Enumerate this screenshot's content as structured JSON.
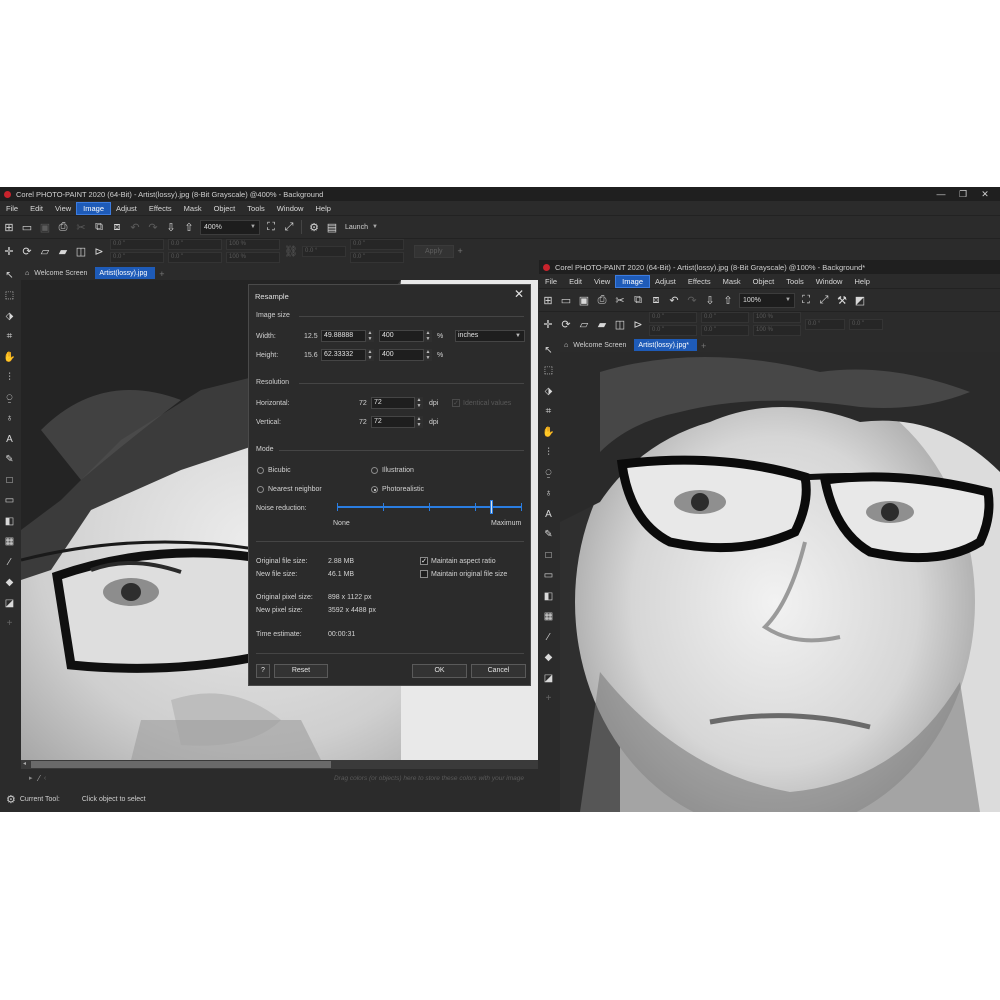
{
  "left_window": {
    "title": "Corel PHOTO-PAINT 2020 (64-Bit) - Artist(lossy).jpg (8-Bit Grayscale) @400% - Background",
    "menu": [
      "File",
      "Edit",
      "View",
      "Image",
      "Adjust",
      "Effects",
      "Mask",
      "Object",
      "Tools",
      "Window",
      "Help"
    ],
    "active_menu": "Image",
    "zoom": "400%",
    "launch_label": "Launch",
    "prop_values": [
      "0.0 \"",
      "0.0 \"",
      "0.0 \"",
      "0.0 \"",
      "100 %",
      "100 %",
      "0.0 °",
      "0.0 \"",
      "0.0 \""
    ],
    "apply_label": "Apply",
    "tabs": [
      "Welcome Screen",
      "Artist(lossy).jpg"
    ],
    "palette_hint": "Drag colors (or objects) here to store these colors with your image",
    "status_label": "Current Tool:",
    "status_value": "Click object to select"
  },
  "dialog": {
    "title": "Resample",
    "image_size_header": "Image size",
    "width_label": "Width:",
    "width_orig": "12.5",
    "width_value": "49.88888",
    "width_pct": "400",
    "height_label": "Height:",
    "height_orig": "15.6",
    "height_value": "62.33332",
    "height_pct": "400",
    "percent_sign": "%",
    "units": "inches",
    "resolution_header": "Resolution",
    "horizontal_label": "Horizontal:",
    "horizontal_orig": "72",
    "horizontal_value": "72",
    "vertical_label": "Vertical:",
    "vertical_orig": "72",
    "vertical_value": "72",
    "dpi": "dpi",
    "identical_values": "Identical values",
    "mode_header": "Mode",
    "mode_bicubic": "Bicubic",
    "mode_illustration": "Illustration",
    "mode_nearest": "Nearest neighbor",
    "mode_photorealistic": "Photorealistic",
    "selected_mode": "Photorealistic",
    "noise_label": "Noise reduction:",
    "noise_min": "None",
    "noise_max": "Maximum",
    "noise_level": 0.84,
    "orig_file_size_label": "Original file size:",
    "orig_file_size": "2.88 MB",
    "new_file_size_label": "New file size:",
    "new_file_size": "46.1 MB",
    "orig_pixel_label": "Original pixel size:",
    "orig_pixel": "898 x 1122 px",
    "new_pixel_label": "New pixel size:",
    "new_pixel": "3592 x 4488 px",
    "time_label": "Time estimate:",
    "time_value": "00:00:31",
    "maintain_aspect": "Maintain aspect ratio",
    "maintain_aspect_checked": true,
    "maintain_file_size": "Maintain original file size",
    "maintain_file_size_checked": false,
    "help_label": "?",
    "reset_label": "Reset",
    "ok_label": "OK",
    "cancel_label": "Cancel"
  },
  "right_window": {
    "title": "Corel PHOTO-PAINT 2020 (64-Bit) - Artist(lossy).jpg (8-Bit Grayscale) @100% - Background*",
    "menu": [
      "File",
      "Edit",
      "View",
      "Image",
      "Adjust",
      "Effects",
      "Mask",
      "Object",
      "Tools",
      "Window",
      "Help"
    ],
    "active_menu": "Image",
    "zoom": "100%",
    "prop_values": [
      "0.0 \"",
      "0.0 \"",
      "0.0 \"",
      "0.0 \"",
      "100 %",
      "100 %",
      "0.0 °",
      "0.0 \""
    ],
    "tabs": [
      "Welcome Screen",
      "Artist(lossy).jpg*"
    ]
  },
  "colors": {
    "accent": "#1e5bb8",
    "chrome": "#2b2b2b",
    "titlebar": "#1f1f1f",
    "text": "#d6d6d6"
  }
}
